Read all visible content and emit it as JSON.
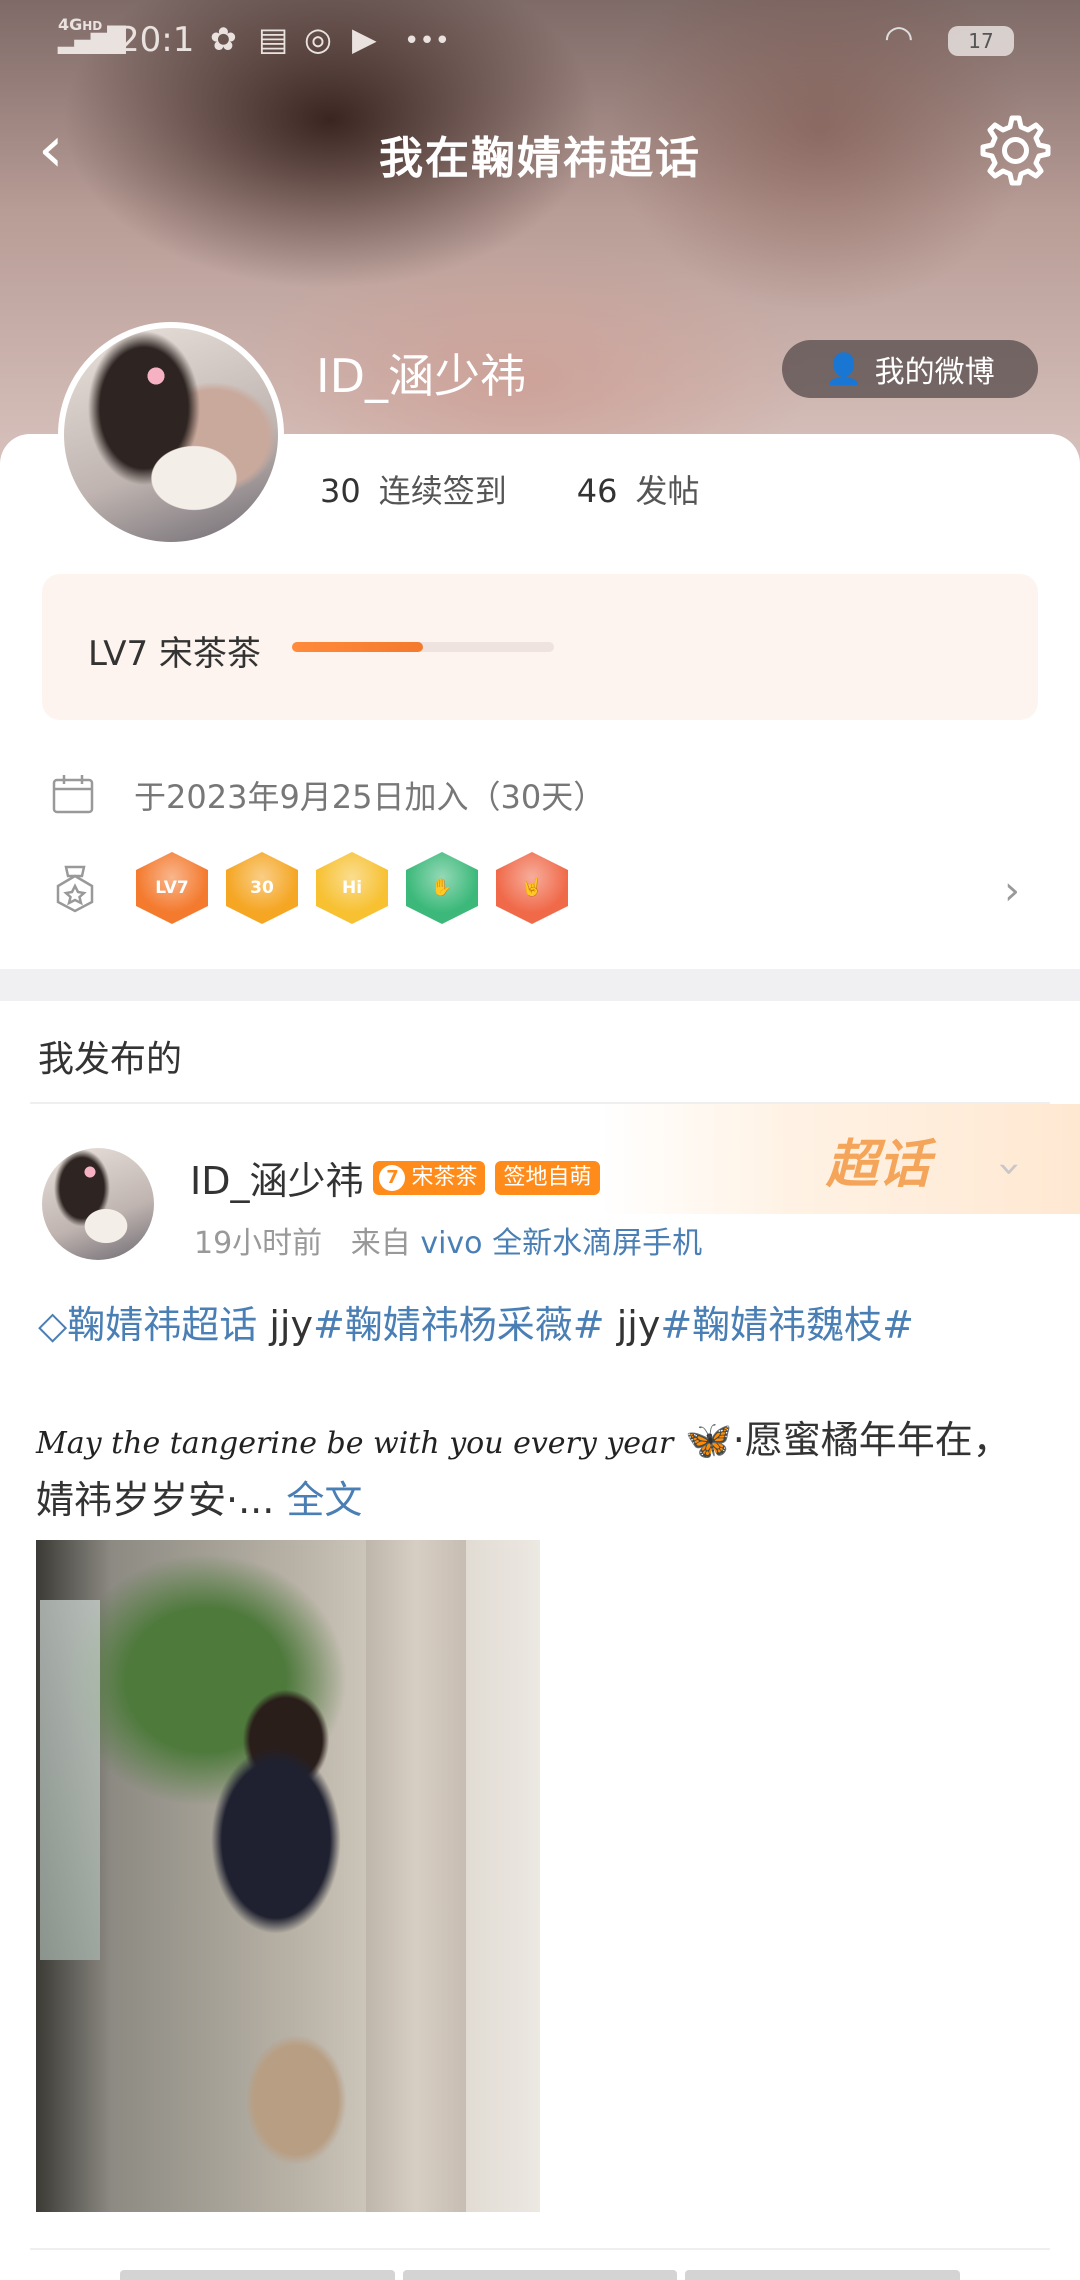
{
  "status_bar": {
    "network": "4G",
    "network_hd": "HD",
    "time": "20:1",
    "icons": [
      "pinwheel-icon",
      "card-icon",
      "weibo-icon",
      "video-icon",
      "more-icon"
    ],
    "more": "•••",
    "battery": "17"
  },
  "header": {
    "back": "‹",
    "title": "我在鞠婧祎超话",
    "username": "ID_涵少祎",
    "my_weibo_button": "我的微博"
  },
  "profile": {
    "stats": [
      {
        "value": "30",
        "label": "连续签到"
      },
      {
        "value": "46",
        "label": "发帖"
      }
    ],
    "level": {
      "text": "LV7 宋茶茶",
      "progress": 0.5
    },
    "join_text": "于2023年9月25日加入（30天）",
    "badges": [
      {
        "name": "lv7-badge",
        "text": "LV7",
        "color": "#f47a2e"
      },
      {
        "name": "30-days-badge",
        "text": "30",
        "color": "#f5a623"
      },
      {
        "name": "hi-badge",
        "text": "Hi",
        "color": "#f7c132"
      },
      {
        "name": "hand-badge",
        "text": "✋",
        "color": "#3cb97a"
      },
      {
        "name": "rock-hand-badge",
        "text": "🤘",
        "color": "#f06a4a"
      }
    ]
  },
  "section": {
    "title": "我发布的"
  },
  "post": {
    "username": "ID_涵少祎",
    "level_num": "7",
    "level_name": "宋茶茶",
    "sign_tag": "签地自萌",
    "banner": "超话",
    "time": "19小时前",
    "from_prefix": "来自",
    "source": "vivo 全新水滴屏手机",
    "topic1": "鞠婧祎超话",
    "plain1": " jjy",
    "topic2": "#鞠婧祎杨采薇#",
    "plain2": " jjy",
    "topic3": "#鞠婧祎魏枝#",
    "script_text": "May the tangerine be with you every year",
    "emoji": "🦋",
    "body": "·愿蜜橘年年在，婧祎岁岁安·...",
    "full_text": " 全文"
  },
  "colors": {
    "accent_orange": "#ff8c1a",
    "link_blue": "#4a7fb5"
  }
}
